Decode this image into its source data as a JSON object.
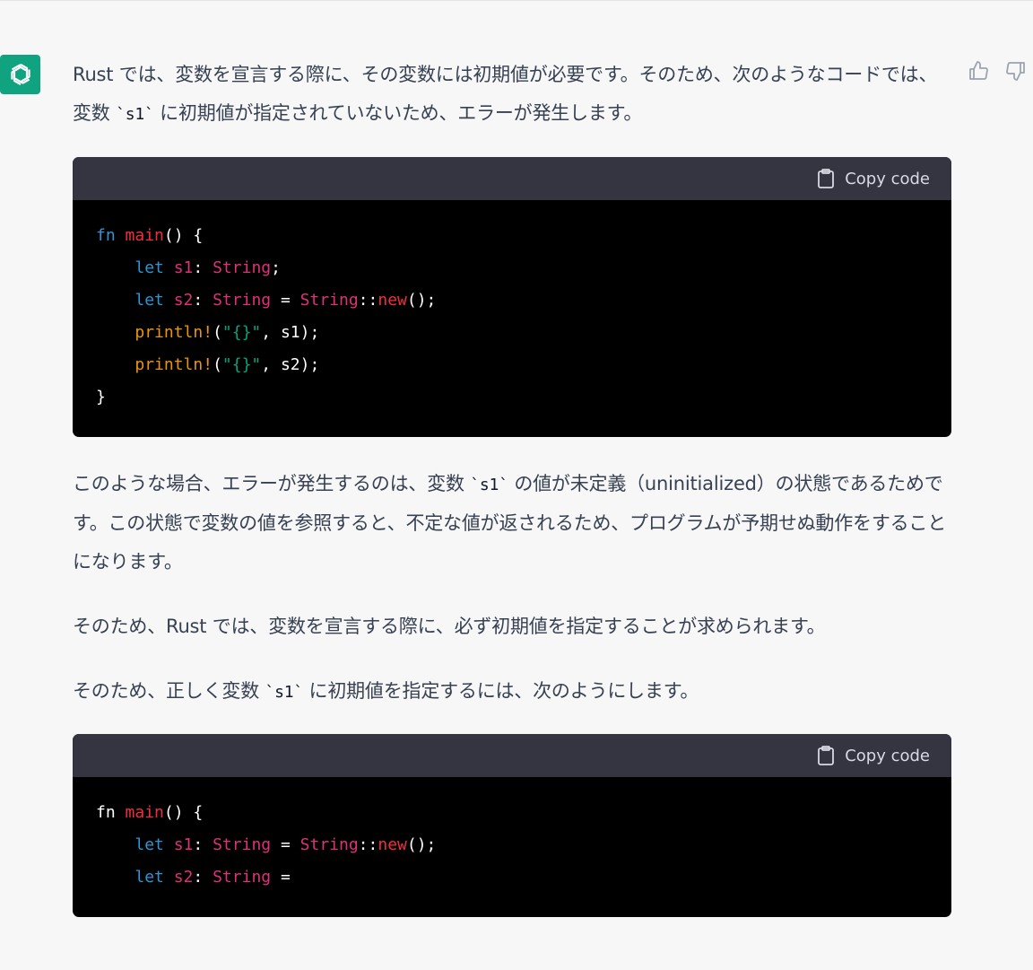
{
  "message": {
    "p1": "Rust では、変数を宣言する際に、その変数には初期値が必要です。そのため、次のようなコードでは、変数 ",
    "p1_code": "`s1`",
    "p1_tail": " に初期値が指定されていないため、エラーが発生します。",
    "p2": "このような場合、エラーが発生するのは、変数 ",
    "p2_code": "`s1`",
    "p2_tail": " の値が未定義（uninitialized）の状態であるためです。この状態で変数の値を参照すると、不定な値が返されるため、プログラムが予期せぬ動作をすることになります。",
    "p3": "そのため、Rust では、変数を宣言する際に、必ず初期値を指定することが求められます。",
    "p4": "そのため、正しく変数 ",
    "p4_code": "`s1`",
    "p4_tail": " に初期値を指定するには、次のようにします。"
  },
  "codeblocks": [
    {
      "copy_label": "Copy code",
      "lines": [
        [
          [
            "kw",
            "fn"
          ],
          [
            "plain",
            " "
          ],
          [
            "fn",
            "main"
          ],
          [
            "plain",
            "() {"
          ]
        ],
        [
          [
            "plain",
            "    "
          ],
          [
            "kw",
            "let"
          ],
          [
            "plain",
            " "
          ],
          [
            "var",
            "s1"
          ],
          [
            "plain",
            ": "
          ],
          [
            "ty",
            "String"
          ],
          [
            "plain",
            ";"
          ]
        ],
        [
          [
            "plain",
            "    "
          ],
          [
            "kw",
            "let"
          ],
          [
            "plain",
            " "
          ],
          [
            "var",
            "s2"
          ],
          [
            "plain",
            ": "
          ],
          [
            "ty",
            "String"
          ],
          [
            "plain",
            " = "
          ],
          [
            "ty",
            "String"
          ],
          [
            "plain",
            "::"
          ],
          [
            "fn",
            "new"
          ],
          [
            "plain",
            "();"
          ]
        ],
        [
          [
            "plain",
            "    "
          ],
          [
            "mac",
            "println!"
          ],
          [
            "plain",
            "("
          ],
          [
            "str",
            "\"{}\""
          ],
          [
            "plain",
            ", s1);"
          ]
        ],
        [
          [
            "plain",
            "    "
          ],
          [
            "mac",
            "println!"
          ],
          [
            "plain",
            "("
          ],
          [
            "str",
            "\"{}\""
          ],
          [
            "plain",
            ", s2);"
          ]
        ],
        [
          [
            "plain",
            "}"
          ]
        ]
      ]
    },
    {
      "copy_label": "Copy code",
      "lines": [
        [
          [
            "plain",
            "fn"
          ],
          [
            "plain",
            " "
          ],
          [
            "fn",
            "main"
          ],
          [
            "plain",
            "() {"
          ]
        ],
        [
          [
            "plain",
            "    "
          ],
          [
            "kw",
            "let"
          ],
          [
            "plain",
            " "
          ],
          [
            "var",
            "s1"
          ],
          [
            "plain",
            ": "
          ],
          [
            "ty",
            "String"
          ],
          [
            "plain",
            " = "
          ],
          [
            "ty",
            "String"
          ],
          [
            "plain",
            "::"
          ],
          [
            "fn",
            "new"
          ],
          [
            "plain",
            "();"
          ]
        ],
        [
          [
            "plain",
            "    "
          ],
          [
            "kw",
            "let"
          ],
          [
            "plain",
            " "
          ],
          [
            "var",
            "s2"
          ],
          [
            "plain",
            ": "
          ],
          [
            "ty",
            "String"
          ],
          [
            "plain",
            " ="
          ]
        ]
      ]
    }
  ],
  "icons": {
    "avatar": "openai-logo-icon",
    "thumbs_up": "thumbs-up-icon",
    "thumbs_down": "thumbs-down-icon",
    "clipboard": "clipboard-icon"
  },
  "colors": {
    "avatar_bg": "#10a37f",
    "code_header_bg": "#343541",
    "code_bg": "#000000",
    "keyword": "#2e95d3",
    "function": "#f22c3d",
    "type": "#df3079",
    "macro": "#e9950c",
    "string": "#00a67d"
  }
}
